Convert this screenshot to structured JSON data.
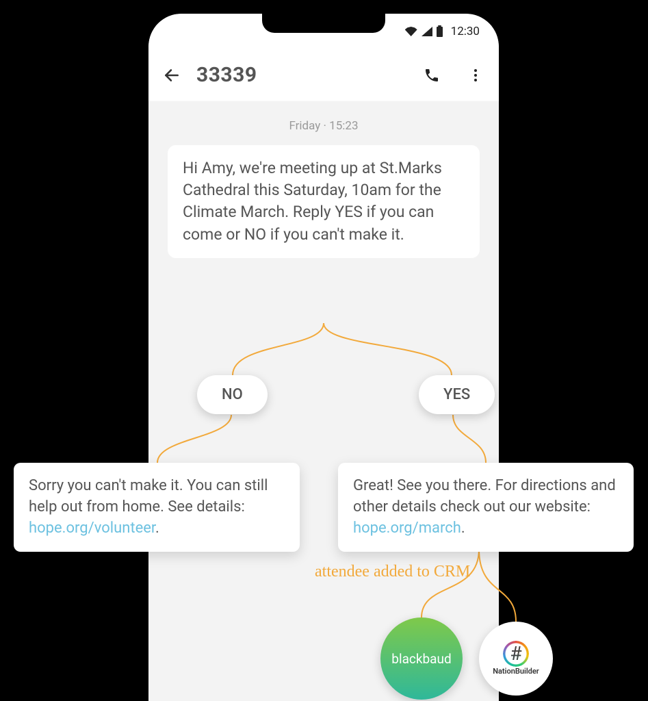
{
  "statusbar": {
    "time": "12:30"
  },
  "header": {
    "title": "33339",
    "icons": {
      "back": "back-arrow",
      "call": "phone",
      "more": "more-vert"
    }
  },
  "conversation": {
    "timestamp": "Friday · 15:23",
    "incoming": "Hi Amy, we're meeting up at St.Marks Cathedral this Saturday, 10am for the Climate March. Reply YES if you can come or NO if you can't make it."
  },
  "branches": {
    "no_label": "NO",
    "yes_label": "YES",
    "no_response_prefix": "Sorry you can't make it. You can still help out from home. See details: ",
    "no_response_link": "hope.org/volunteer",
    "no_response_suffix": ".",
    "yes_response_prefix": "Great! See you there. For directions and other details check out our website: ",
    "yes_response_link": "hope.org/march",
    "yes_response_suffix": "."
  },
  "annotation": "attendee added to CRM",
  "crm": {
    "blackbaud": "blackbaud",
    "nationbuilder": "NationBuilder",
    "hash": "#"
  },
  "colors": {
    "connector": "#f2a93b",
    "link": "#6cc1e0"
  }
}
